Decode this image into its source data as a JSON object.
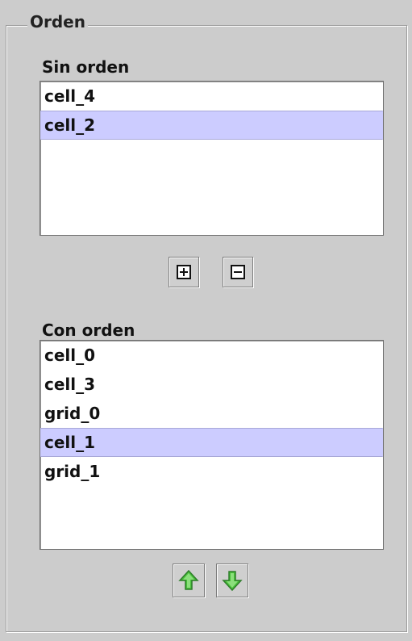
{
  "panel": {
    "title": "Orden"
  },
  "unordered": {
    "label": "Sin orden",
    "items": [
      {
        "label": "cell_4",
        "selected": false
      },
      {
        "label": "cell_2",
        "selected": true
      }
    ]
  },
  "ordered": {
    "label": "Con orden",
    "items": [
      {
        "label": "cell_0",
        "selected": false
      },
      {
        "label": "cell_3",
        "selected": false
      },
      {
        "label": "grid_0",
        "selected": false
      },
      {
        "label": "cell_1",
        "selected": true
      },
      {
        "label": "grid_1",
        "selected": false
      }
    ]
  },
  "buttons": {
    "add_icon": "plus-box-icon",
    "remove_icon": "minus-box-icon",
    "move_up_icon": "arrow-up-icon",
    "move_down_icon": "arrow-down-icon"
  },
  "colors": {
    "panel_background": "#cccccc",
    "selection": "#ccccff",
    "arrow_green": "#49c13b"
  }
}
